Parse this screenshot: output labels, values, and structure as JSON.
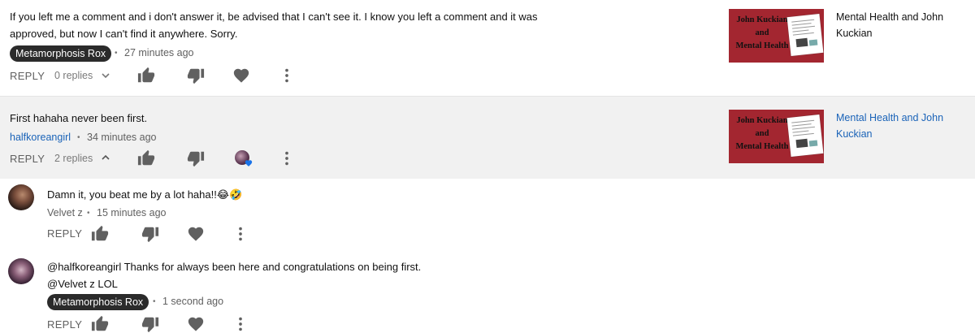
{
  "comments": [
    {
      "text_line1": "If you left me a comment and i don't answer it, be advised that I can't see it. I know you left a comment and it was",
      "text_line2": "approved, but now I can't find it anywhere. Sorry.",
      "author": "Metamorphosis Rox",
      "time": "27 minutes ago",
      "reply_label": "REPLY",
      "replies_label": "0 replies",
      "video": {
        "thumb_line1": "John Kuckian",
        "thumb_line2": "and",
        "thumb_line3": "Mental Health",
        "title_line1": "Mental Health and John",
        "title_line2": "Kuckian"
      }
    },
    {
      "text": "First hahaha never been first.",
      "author": "halfkoreangirl",
      "time": "34 minutes ago",
      "reply_label": "REPLY",
      "replies_label": "2 replies",
      "video": {
        "thumb_line1": "John Kuckian",
        "thumb_line2": "and",
        "thumb_line3": "Mental Health",
        "title_line1": "Mental Health and John",
        "title_line2": "Kuckian"
      }
    }
  ],
  "replies": [
    {
      "text": "Damn it,  you beat me by a lot haha!!😂🤣",
      "author": "Velvet z",
      "time": "15 minutes ago",
      "reply_label": "REPLY"
    },
    {
      "text_line1": "@halfkoreangirl Thanks for always been here and congratulations on being first.",
      "text_line2": "@Velvet z LOL",
      "author": "Metamorphosis Rox",
      "time": "1 second ago",
      "reply_label": "REPLY"
    }
  ],
  "separator": "•",
  "colors": {
    "highlight_bg": "#f1f1f1",
    "link_blue": "#1a63b8",
    "thumb_red": "#a32630",
    "icon_gray": "#606060",
    "heart_badge": "#1a73e8"
  },
  "icons": [
    "thumb-up-icon",
    "thumb-down-icon",
    "heart-icon",
    "more-vert-icon",
    "chevron-down-icon",
    "chevron-up-icon"
  ]
}
